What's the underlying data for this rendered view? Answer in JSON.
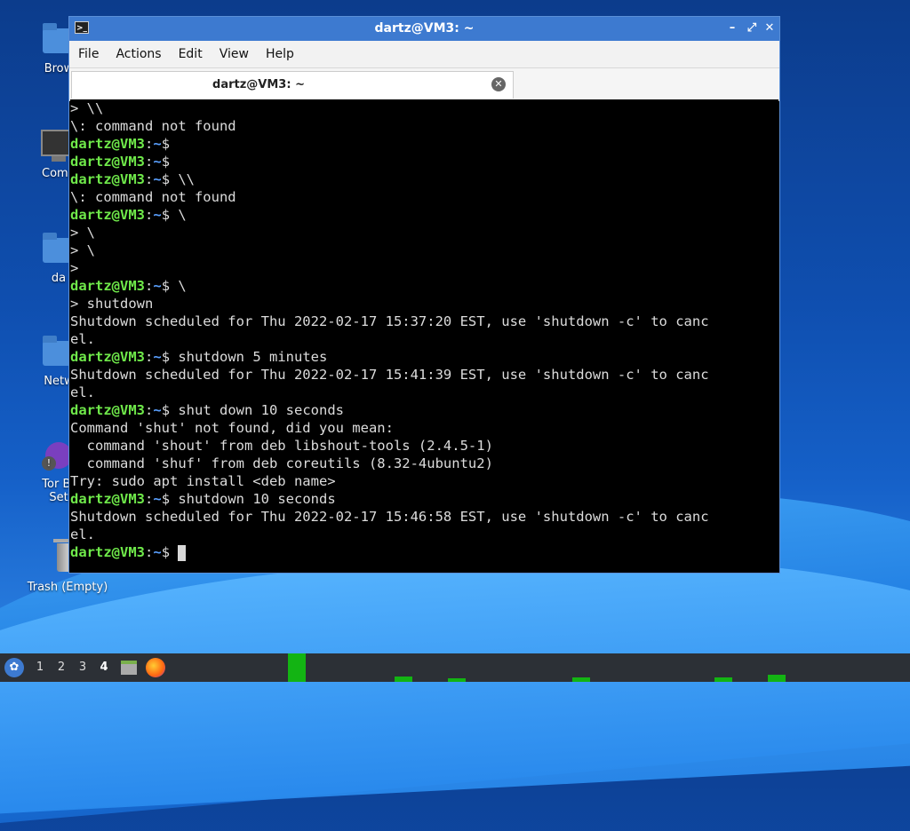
{
  "desktop": {
    "icons": [
      {
        "label": "Brow",
        "kind": "folder"
      },
      {
        "label": "Comp",
        "kind": "monitor"
      },
      {
        "label": "da",
        "kind": "folder"
      },
      {
        "label": "Netw",
        "kind": "folder"
      },
      {
        "label": "Tor Br",
        "label2": "Set",
        "kind": "tor"
      },
      {
        "label": "Trash (Empty)",
        "kind": "trash"
      }
    ]
  },
  "window": {
    "title": "dartz@VM3: ~",
    "controls": {
      "minimize": "–",
      "maximize": "⤢",
      "close": "✕"
    },
    "menu": [
      "File",
      "Actions",
      "Edit",
      "View",
      "Help"
    ],
    "tab": {
      "label": "dartz@VM3: ~",
      "close": "✕"
    }
  },
  "terminal": {
    "user": "dartz@VM3",
    "path": "~",
    "lines": [
      {
        "t": "text",
        "text": "> \\\\"
      },
      {
        "t": "text",
        "text": "\\: command not found"
      },
      {
        "t": "prompt",
        "cmd": ""
      },
      {
        "t": "prompt",
        "cmd": ""
      },
      {
        "t": "prompt",
        "cmd": " \\\\"
      },
      {
        "t": "text",
        "text": "\\: command not found"
      },
      {
        "t": "prompt",
        "cmd": " \\"
      },
      {
        "t": "text",
        "text": "> \\"
      },
      {
        "t": "text",
        "text": "> \\"
      },
      {
        "t": "text",
        "text": ">"
      },
      {
        "t": "prompt",
        "cmd": " \\"
      },
      {
        "t": "text",
        "text": "> shutdown"
      },
      {
        "t": "text",
        "text": "Shutdown scheduled for Thu 2022-02-17 15:37:20 EST, use 'shutdown -c' to canc"
      },
      {
        "t": "text",
        "text": "el."
      },
      {
        "t": "prompt",
        "cmd": " shutdown 5 minutes"
      },
      {
        "t": "text",
        "text": "Shutdown scheduled for Thu 2022-02-17 15:41:39 EST, use 'shutdown -c' to canc"
      },
      {
        "t": "text",
        "text": "el."
      },
      {
        "t": "prompt",
        "cmd": " shut down 10 seconds"
      },
      {
        "t": "text",
        "text": "Command 'shut' not found, did you mean:"
      },
      {
        "t": "text",
        "text": "  command 'shout' from deb libshout-tools (2.4.5-1)"
      },
      {
        "t": "text",
        "text": "  command 'shuf' from deb coreutils (8.32-4ubuntu2)"
      },
      {
        "t": "text",
        "text": "Try: sudo apt install <deb name>"
      },
      {
        "t": "prompt",
        "cmd": " shutdown 10 seconds"
      },
      {
        "t": "text",
        "text": "Shutdown scheduled for Thu 2022-02-17 15:46:58 EST, use 'shutdown -c' to canc"
      },
      {
        "t": "text",
        "text": "el."
      },
      {
        "t": "prompt",
        "cmd": " ",
        "cursor": true
      }
    ]
  },
  "taskbar": {
    "start_icon": "lubuntu-start-icon",
    "workspaces": [
      "1",
      "2",
      "3",
      "4"
    ],
    "active_workspace": "4",
    "launchers": [
      "file-manager-icon",
      "firefox-icon"
    ],
    "cpu_graph_color": "#13b413"
  },
  "colors": {
    "titlebar": "#3d7ad0",
    "prompt_user": "#6fe94a",
    "prompt_path": "#5aa0ff",
    "terminal_bg": "#000000"
  }
}
